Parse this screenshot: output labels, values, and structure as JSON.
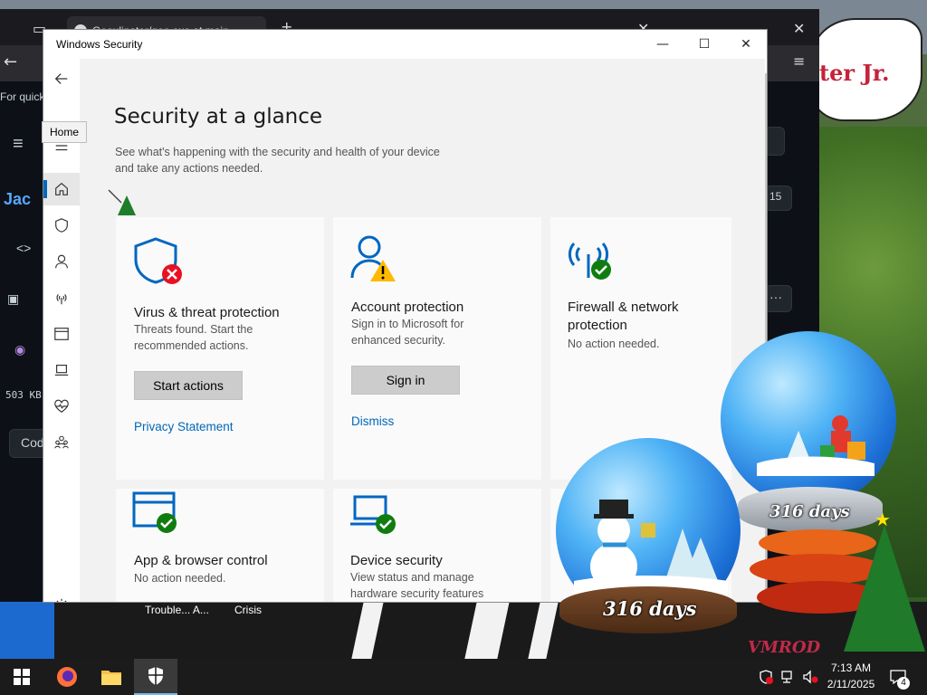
{
  "desktop": {
    "wallpaper_caption": "ter Jr.",
    "taskbar_labels": [
      "Trouble... A...",
      "Crisis"
    ],
    "signature": "VMROD"
  },
  "browser": {
    "tab_title": "Geoulinator/geo.exe at main",
    "side_fragments": [
      "For quick",
      "Jac",
      "503 KB",
      "Cod"
    ],
    "tab_hint": "15"
  },
  "window": {
    "title": "Windows Security",
    "tooltip": "Home",
    "nav_icons": [
      "back-icon",
      "menu-icon",
      "home-icon",
      "shield-icon",
      "person-icon",
      "antenna-icon",
      "browser-window-icon",
      "laptop-icon",
      "heart-monitor-icon",
      "family-icon",
      "settings-icon"
    ]
  },
  "main": {
    "title": "Security at a glance",
    "subtitle_line1": "See what's happening with the security and health of your device",
    "subtitle_line2": "and take any actions needed.",
    "tiles": [
      {
        "title": "Virus & threat protection",
        "desc_line1": "Threats found. Start the",
        "desc_line2": "recommended actions.",
        "button": "Start actions",
        "link": "Privacy Statement",
        "status": "error"
      },
      {
        "title": "Account protection",
        "desc_line1": "Sign in to Microsoft for",
        "desc_line2": "enhanced security.",
        "button": "Sign in",
        "link": "Dismiss",
        "status": "warning"
      },
      {
        "title_line1": "Firewall & network",
        "title_line2": "protection",
        "desc_line1": "No action needed.",
        "status": "ok"
      },
      {
        "title": "App & browser control",
        "desc_line1": "No action needed.",
        "status": "ok"
      },
      {
        "title": "Device security",
        "desc_line1": "View status and manage",
        "desc_line2": "hardware security features",
        "status": "ok"
      }
    ]
  },
  "decorations": {
    "globe_large_label": "316 days",
    "globe_small_label": "316 days"
  },
  "taskbar": {
    "time": "7:13 AM",
    "date": "2/11/2025",
    "notification_count": "4",
    "accent": "#76b9ed"
  },
  "colors": {
    "accent_blue": "#0067c0",
    "link_blue": "#0067b8",
    "ok_green": "#107c10",
    "error_red": "#e81123",
    "warning_yellow": "#ffb900"
  }
}
